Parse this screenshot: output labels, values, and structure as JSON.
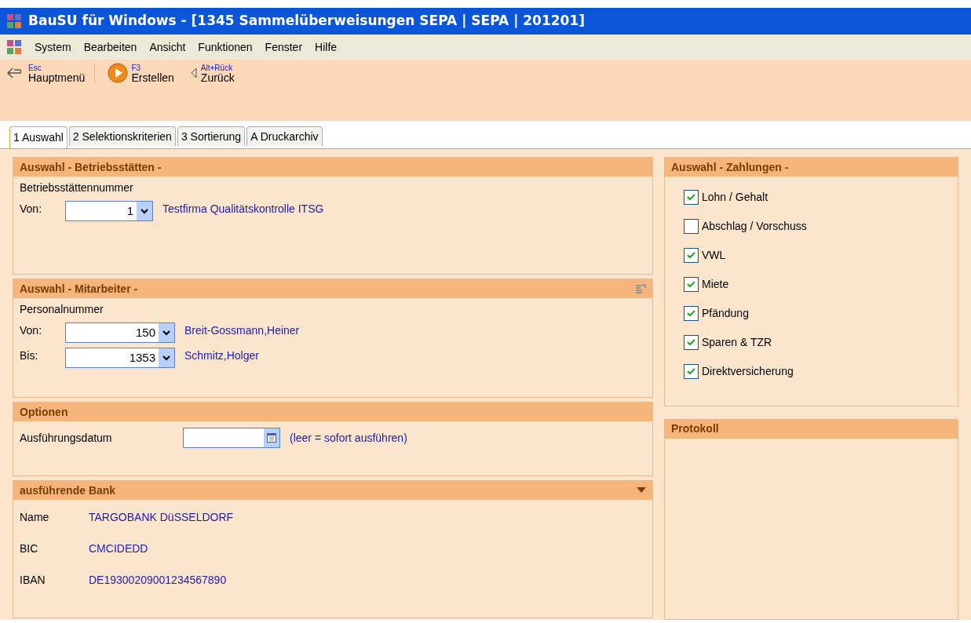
{
  "window": {
    "title": "BauSU für Windows - [1345 Sammelüberweisungen SEPA | SEPA | 201201]"
  },
  "menu": [
    "System",
    "Bearbeiten",
    "Ansicht",
    "Funktionen",
    "Fenster",
    "Hilfe"
  ],
  "toolbar": [
    {
      "kind": "back",
      "shortcut": "Esc",
      "label": "Hauptmenü"
    },
    {
      "kind": "play",
      "shortcut": "F3",
      "label": "Erstellen"
    },
    {
      "kind": "prev",
      "shortcut": "Alt+Rück",
      "label": "Zurück"
    }
  ],
  "tabs": [
    {
      "label": "1 Auswahl",
      "selected": true
    },
    {
      "label": "2 Selektionskriterien",
      "selected": false
    },
    {
      "label": "3 Sortierung",
      "selected": false
    },
    {
      "label": "A Druckarchiv",
      "selected": false
    }
  ],
  "betriebsstaetten": {
    "title": "Auswahl - Betriebsstätten -",
    "label": "Betriebsstättennummer",
    "rows": [
      {
        "label": "Von:",
        "value": "1",
        "name": "Testfirma Qualitätskontrolle ITSG"
      }
    ]
  },
  "mitarbeiter": {
    "title": "Auswahl - Mitarbeiter -",
    "label": "Personalnummer",
    "rows": [
      {
        "label": "Von:",
        "value": "150",
        "name": "Breit-Gossmann,Heiner"
      },
      {
        "label": "Bis:",
        "value": "1353",
        "name": "Schmitz,Holger"
      }
    ]
  },
  "optionen": {
    "title": "Optionen",
    "label": "Ausführungsdatum",
    "hint": "(leer = sofort ausführen)"
  },
  "bank": {
    "title": "ausführende Bank",
    "fields": [
      {
        "label": "Name",
        "value": "TARGOBANK DüSSELDORF"
      },
      {
        "label": "BIC",
        "value": "CMCIDEDD"
      },
      {
        "label": "IBAN",
        "value": "DE19300209001234567890"
      }
    ]
  },
  "zahlungen": {
    "title": "Auswahl - Zahlungen -",
    "items": [
      {
        "label": "Lohn / Gehalt",
        "checked": true
      },
      {
        "label": "Abschlag / Vorschuss",
        "checked": false
      },
      {
        "label": "VWL",
        "checked": true
      },
      {
        "label": "Miete",
        "checked": true
      },
      {
        "label": "Pfändung",
        "checked": true
      },
      {
        "label": "Sparen & TZR",
        "checked": true
      },
      {
        "label": "Direktversicherung",
        "checked": true
      }
    ]
  },
  "protokoll": {
    "title": "Protokoll"
  }
}
